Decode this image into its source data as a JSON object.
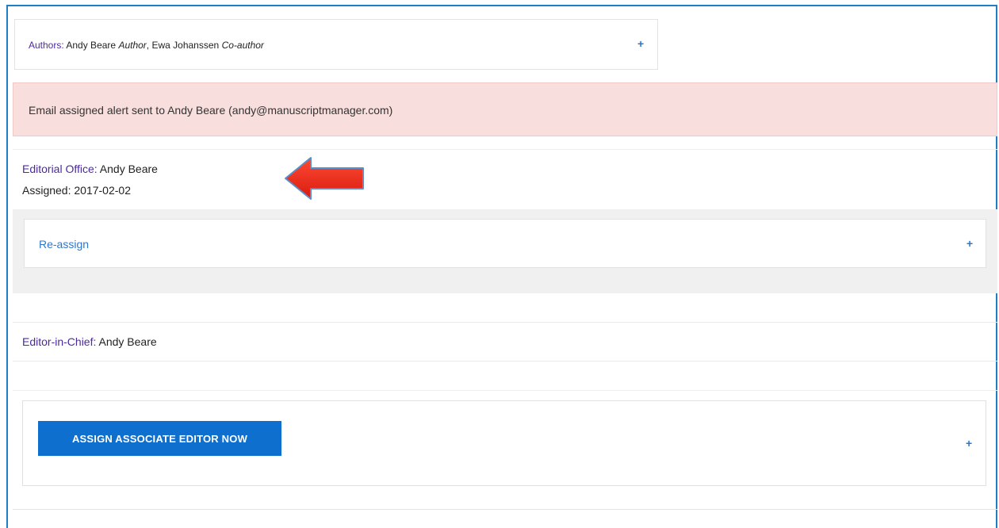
{
  "authors": {
    "label": "Authors:",
    "author1_name": "Andy Beare",
    "author1_role": "Author",
    "separator": ",",
    "author2_name": "Ewa Johanssen",
    "author2_role": "Co-author",
    "expand_symbol": "+"
  },
  "alert": {
    "message": "Email assigned alert sent to Andy Beare (andy@manuscriptmanager.com)"
  },
  "editorial_office": {
    "label": "Editorial Office:",
    "name": "Andy Beare",
    "assigned_label": "Assigned:",
    "assigned_date": "2017-02-02"
  },
  "reassign": {
    "label": "Re-assign",
    "expand_symbol": "+"
  },
  "editor_in_chief": {
    "label": "Editor-in-Chief:",
    "name": "Andy Beare"
  },
  "associate_editor": {
    "button_label": "ASSIGN ASSOCIATE EDITOR NOW",
    "expand_symbol": "+"
  },
  "colors": {
    "frame_border": "#1e7ec8",
    "alert_bg": "#f8dedc",
    "link_blue": "#2f76c9",
    "label_purple": "#4b2aa0",
    "button_blue": "#0e6fcf",
    "arrow_red": "#e8261a"
  },
  "icons": [
    "annotation-arrow-icon",
    "expand-plus-icon"
  ]
}
